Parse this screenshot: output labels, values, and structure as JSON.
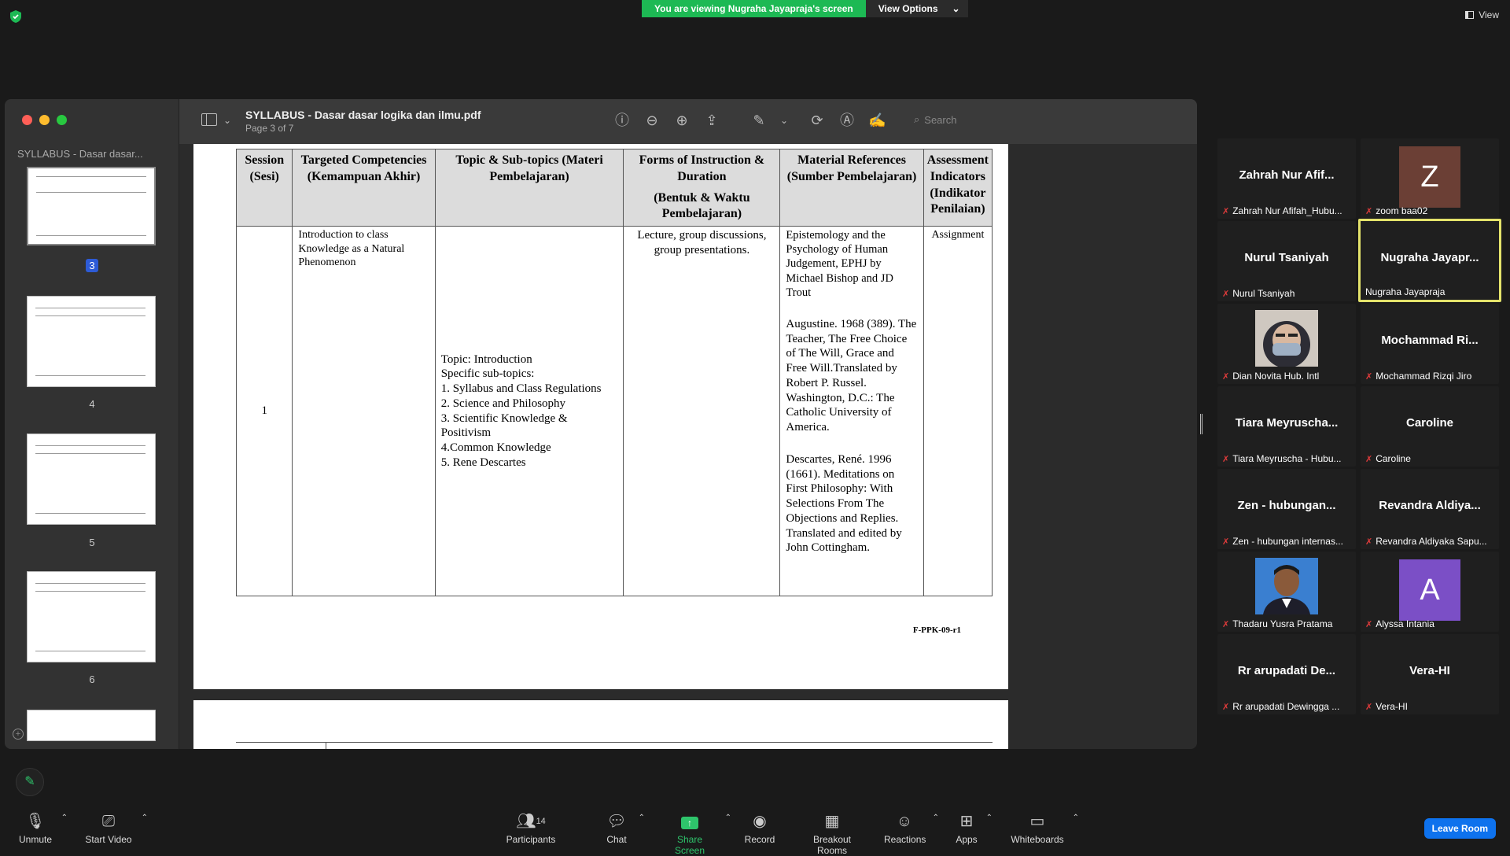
{
  "banner": {
    "viewing": "You are viewing Nugraha Jayapraja's screen",
    "options": "View Options"
  },
  "view_label": "View",
  "pdf": {
    "title": "SYLLABUS - Dasar dasar logika dan ilmu.pdf",
    "page_info": "Page 3 of 7",
    "sidebar_title": "SYLLABUS - Dasar dasar...",
    "search_placeholder": "Search",
    "thumbs": [
      "3",
      "4",
      "5",
      "6"
    ]
  },
  "table": {
    "headers": [
      "Session (Sesi)",
      "Targeted Competencies (Kemampuan Akhir)",
      "Topic & Sub-topics (Materi Pembelajaran)",
      "Forms of Instruction & Duration",
      "(Bentuk & Waktu Pembelajaran)",
      "Material References (Sumber Pembelajaran)",
      "Assessment Indicators (Indikator Penilaian)"
    ],
    "row": {
      "session": "1",
      "competency": "Introduction to class Knowledge as a Natural Phenomenon",
      "topic": [
        "Topic: Introduction",
        "Specific sub-topics:",
        "1. Syllabus and Class Regulations",
        "2. Science and Philosophy",
        "3. Scientific Knowledge & Positivism",
        "4.Common Knowledge",
        "5. Rene Descartes"
      ],
      "forms": "Lecture, group discussions, group presentations.",
      "references": [
        "Epistemology and the Psychology of Human Judgement, EPHJ by Michael Bishop and JD Trout",
        "Augustine. 1968 (389). The Teacher, The Free Choice of The Will, Grace and Free Will.Translated by Robert P. Russel. Washington, D.C.: The Catholic University of America.",
        "Descartes, René. 1996 (1661). Meditations on First Philosophy: With Selections From The Objections and Replies. Translated and edited by John Cottingham."
      ],
      "assessment": "Assignment"
    },
    "footer_code": "F-PPK-09-r1"
  },
  "participants": [
    {
      "name": "Zahrah Nur Afif...",
      "label": "Zahrah Nur Afifah_Hubu..."
    },
    {
      "avatar": "Z",
      "label": "zoom baa02",
      "color": "#6b3f35"
    },
    {
      "name": "Nurul Tsaniyah",
      "label": "Nurul Tsaniyah"
    },
    {
      "name": "Nugraha Jayapr...",
      "label": "Nugraha Jayapraja"
    },
    {
      "label": "Dian Novita Hub. Intl"
    },
    {
      "name": "Mochammad Ri...",
      "label": "Mochammad Rizqi Jiro"
    },
    {
      "name": "Tiara Meyruscha...",
      "label": "Tiara Meyruscha - Hubu..."
    },
    {
      "name": "Caroline",
      "label": "Caroline"
    },
    {
      "name": "Zen - hubungan...",
      "label": "Zen - hubungan internas..."
    },
    {
      "name": "Revandra Aldiya...",
      "label": "Revandra Aldiyaka Sapu..."
    },
    {
      "label": "Thadaru Yusra Pratama"
    },
    {
      "avatar": "A",
      "label": "Alyssa Intania",
      "color": "#7b4fc6"
    },
    {
      "name": "Rr arupadati De...",
      "label": "Rr arupadati Dewingga ..."
    },
    {
      "name": "Vera-HI",
      "label": "Vera-HI"
    }
  ],
  "toolbar": {
    "unmute": "Unmute",
    "start_video": "Start Video",
    "participants": "Participants",
    "participants_count": "14",
    "chat": "Chat",
    "share_screen": "Share Screen",
    "record": "Record",
    "breakout": "Breakout Rooms",
    "reactions": "Reactions",
    "apps": "Apps",
    "whiteboards": "Whiteboards",
    "leave": "Leave Room"
  },
  "colors": {
    "accent_green": "#1db954",
    "leave_blue": "#0e72ed",
    "active_border": "#e4e36b"
  }
}
